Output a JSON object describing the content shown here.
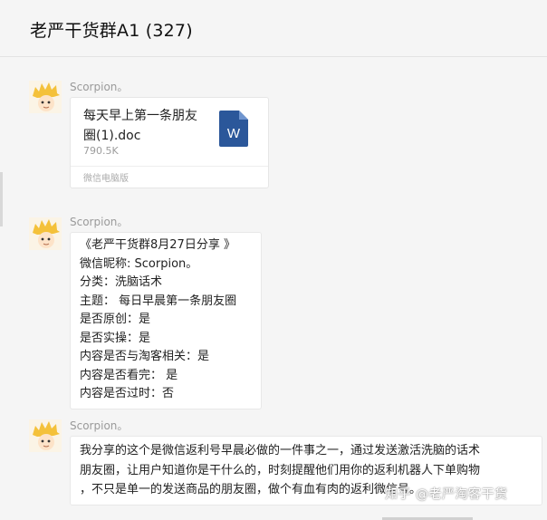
{
  "chat": {
    "title": "老严干货群A1 (327)"
  },
  "messages": [
    {
      "sender": "Scorpion。",
      "file": {
        "name_lines": [
          "每天早上第一条朋友",
          "圈(1).doc"
        ],
        "size": "790.5K",
        "source": "微信电脑版",
        "icon_letter": "W"
      }
    },
    {
      "sender": "Scorpion。",
      "lines": [
        "《老严干货群8月27日分享 》",
        "微信昵称: Scorpion。",
        "分类：洗脑话术",
        "主题： 每日早晨第一条朋友圈",
        "是否原创：是",
        "是否实操：是",
        "内容是否与淘客相关：是",
        "内容是否看完： 是",
        "内容是否过时：否"
      ]
    },
    {
      "sender": "Scorpion。",
      "lines": [
        "我分享的这个是微信返利号早晨必做的一件事之一，通过发送激活洗脑的话术",
        "朋友圈，让用户知道你是干什么的，时刻提醒他们用你的返利机器人下单购物",
        "，不只是单一的发送商品的朋友圈，做个有血有肉的返利微信号。"
      ]
    }
  ],
  "watermark": "知乎 @老严淘客干货",
  "colors": {
    "word_icon": "#2b579a",
    "bubble_bg": "#ffffff",
    "page_bg": "#f5f5f5"
  }
}
